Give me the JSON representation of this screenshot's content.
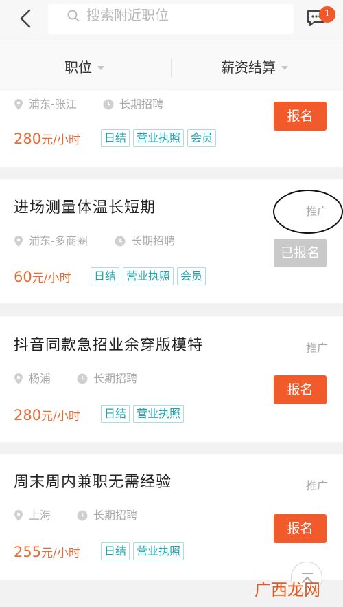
{
  "header": {
    "search_placeholder": "搜索附近职位",
    "message_badge": "1"
  },
  "filters": [
    {
      "label": "职位"
    },
    {
      "label": "薪资结算"
    }
  ],
  "jobs": [
    {
      "title": "",
      "location": "浦东-张江",
      "term": "长期招聘",
      "price_num": "280",
      "price_unit": "元/小时",
      "tags": [
        "日结",
        "营业执照",
        "会员"
      ],
      "button": "报名",
      "promo": ""
    },
    {
      "title": "进场测量体温长短期",
      "location": "浦东-多商圈",
      "term": "长期招聘",
      "price_num": "60",
      "price_unit": "元/小时",
      "tags": [
        "日结",
        "营业执照",
        "会员"
      ],
      "button": "已报名",
      "promo": "推广"
    },
    {
      "title": "抖音同款急招业余穿版模特",
      "location": "杨浦",
      "term": "长期招聘",
      "price_num": "280",
      "price_unit": "元/小时",
      "tags": [
        "日结",
        "营业执照"
      ],
      "button": "报名",
      "promo": "推广"
    },
    {
      "title": "周末周内兼职无需经验",
      "location": "上海",
      "term": "长期招聘",
      "price_num": "255",
      "price_unit": "元/小时",
      "tags": [
        "日结",
        "营业执照"
      ],
      "button": "报名",
      "promo": "推广"
    }
  ],
  "watermark": "广西龙网",
  "colors": {
    "accent": "#f15a2b",
    "price": "#e86a35",
    "tag": "#1aa5b0",
    "disabled": "#c9c9c9"
  }
}
